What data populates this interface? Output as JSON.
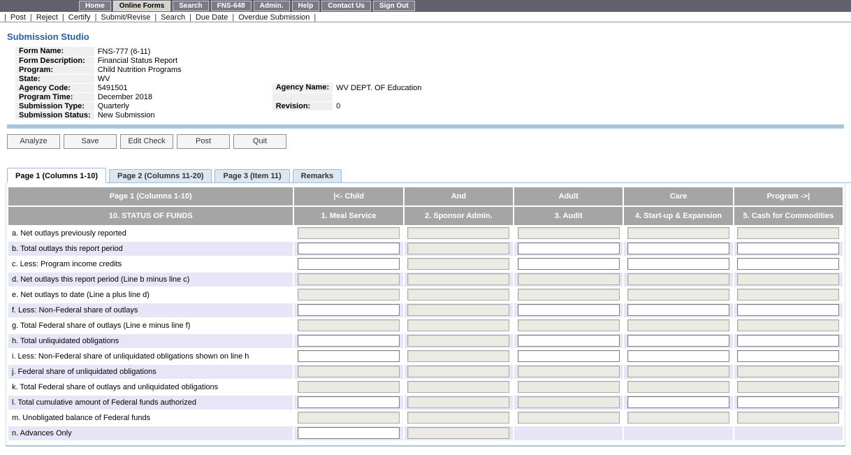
{
  "topnav": {
    "items": [
      {
        "label": "Home",
        "active": false
      },
      {
        "label": "Online Forms",
        "active": true
      },
      {
        "label": "Search",
        "active": false
      },
      {
        "label": "FNS-648",
        "active": false
      },
      {
        "label": "Admin.",
        "active": false
      },
      {
        "label": "Help",
        "active": false
      },
      {
        "label": "Contact Us",
        "active": false
      },
      {
        "label": "Sign Out",
        "active": false
      }
    ]
  },
  "actionbar": {
    "separator": "|",
    "items": [
      "Post",
      "Reject",
      "Certify",
      "Submit/Revise",
      "Search",
      "Due Date",
      "Overdue Submission"
    ]
  },
  "page_title": "Submission Studio",
  "form_info": {
    "rows": [
      {
        "label": "Form Name:",
        "value": "FNS-777 (6-11)"
      },
      {
        "label": "Form Description:",
        "value": "Financial Status Report"
      },
      {
        "label": "Program:",
        "value": "Child Nutrition Programs"
      },
      {
        "label": "State:",
        "value": "WV"
      },
      {
        "label": "Agency Code:",
        "value": "5491501",
        "label2": "Agency Name:",
        "value2": "WV DEPT. OF Education"
      },
      {
        "label": "Program Time:",
        "value": "December 2018",
        "label2": "",
        "value2": ""
      },
      {
        "label": "Submission Type:",
        "value": "Quarterly",
        "label2": "Revision:",
        "value2": "0"
      },
      {
        "label": "Submission Status:",
        "value": "New Submission"
      }
    ]
  },
  "buttons": [
    "Analyze",
    "Save",
    "Edit Check",
    "Post",
    "Quit"
  ],
  "tabs": [
    {
      "label": "Page 1 (Columns 1-10)",
      "active": true
    },
    {
      "label": "Page 2 (Columns 11-20)",
      "active": false
    },
    {
      "label": "Page 3 (Item 11)",
      "active": false
    },
    {
      "label": "Remarks",
      "active": false
    }
  ],
  "table": {
    "header_row1": [
      "Page 1 (Columns 1-10)",
      "|<- Child",
      "And",
      "Adult",
      "Care",
      "Program ->|"
    ],
    "header_row2": [
      "10. STATUS OF FUNDS",
      "1. Meal Service",
      "2. Sponsor Admin.",
      "3. Audit",
      "4. Start-up & Expansion",
      "5. Cash for Commodities"
    ],
    "cell_legend": "e = enabled empty input, d = disabled empty input, none = no input",
    "rows": [
      {
        "label": "a. Net outlays previously reported",
        "cells": [
          "d",
          "d",
          "d",
          "d",
          "d"
        ]
      },
      {
        "label": "b. Total outlays this report period",
        "cells": [
          "e",
          "d",
          "e",
          "e",
          "e"
        ]
      },
      {
        "label": "c. Less: Program income credits",
        "cells": [
          "e",
          "d",
          "e",
          "e",
          "e"
        ]
      },
      {
        "label": "d. Net outlays this report period (Line b minus line c)",
        "cells": [
          "d",
          "d",
          "d",
          "d",
          "d"
        ]
      },
      {
        "label": "e. Net outlays to date (Line a plus line d)",
        "cells": [
          "d",
          "d",
          "d",
          "d",
          "d"
        ]
      },
      {
        "label": "f. Less: Non-Federal share of outlays",
        "cells": [
          "e",
          "d",
          "e",
          "e",
          "e"
        ]
      },
      {
        "label": "g. Total Federal share of outlays (Line e minus line f)",
        "cells": [
          "d",
          "d",
          "d",
          "d",
          "d"
        ]
      },
      {
        "label": "h. Total unliquidated obligations",
        "cells": [
          "e",
          "d",
          "e",
          "e",
          "e"
        ]
      },
      {
        "label": "i. Less: Non-Federal share of unliquidated obligations shown on line h",
        "cells": [
          "e",
          "d",
          "e",
          "e",
          "e"
        ]
      },
      {
        "label": "j. Federal share of unliquidated obligations",
        "cells": [
          "d",
          "d",
          "d",
          "d",
          "d"
        ]
      },
      {
        "label": "k. Total Federal share of outlays and unliquidated obligations",
        "cells": [
          "d",
          "d",
          "d",
          "d",
          "d"
        ]
      },
      {
        "label": "l. Total cumulative amount of Federal funds authorized",
        "cells": [
          "e",
          "d",
          "d",
          "e",
          "e"
        ]
      },
      {
        "label": "m. Unobligated balance of Federal funds",
        "cells": [
          "d",
          "d",
          "d",
          "d",
          "d"
        ]
      },
      {
        "label": "n. Advances Only",
        "cells": [
          "e",
          "d",
          "none",
          "none",
          "none"
        ]
      }
    ]
  },
  "colors": {
    "nav_bg": "#61616e",
    "nav_btn_bg": "#7b7b87",
    "nav_btn_border": "#c8c8d2",
    "nav_active_bg": "#d3d1c9",
    "title_blue": "#2a5caa",
    "info_label_bg": "#efefef",
    "divider_blue": "#a9c6dd",
    "button_border": "#8f8f8f",
    "tab_inactive_bg": "#dde7f3",
    "tab_border": "#9db9d9",
    "panel_border": "#cfe0ef",
    "header_gray": "#a5a5a5",
    "row_alt": "#e6e6f6",
    "input_border": "#7e7e7e",
    "disabled_input_bg": "#ebebe4",
    "disabled_input_border": "#a9a9a9"
  }
}
